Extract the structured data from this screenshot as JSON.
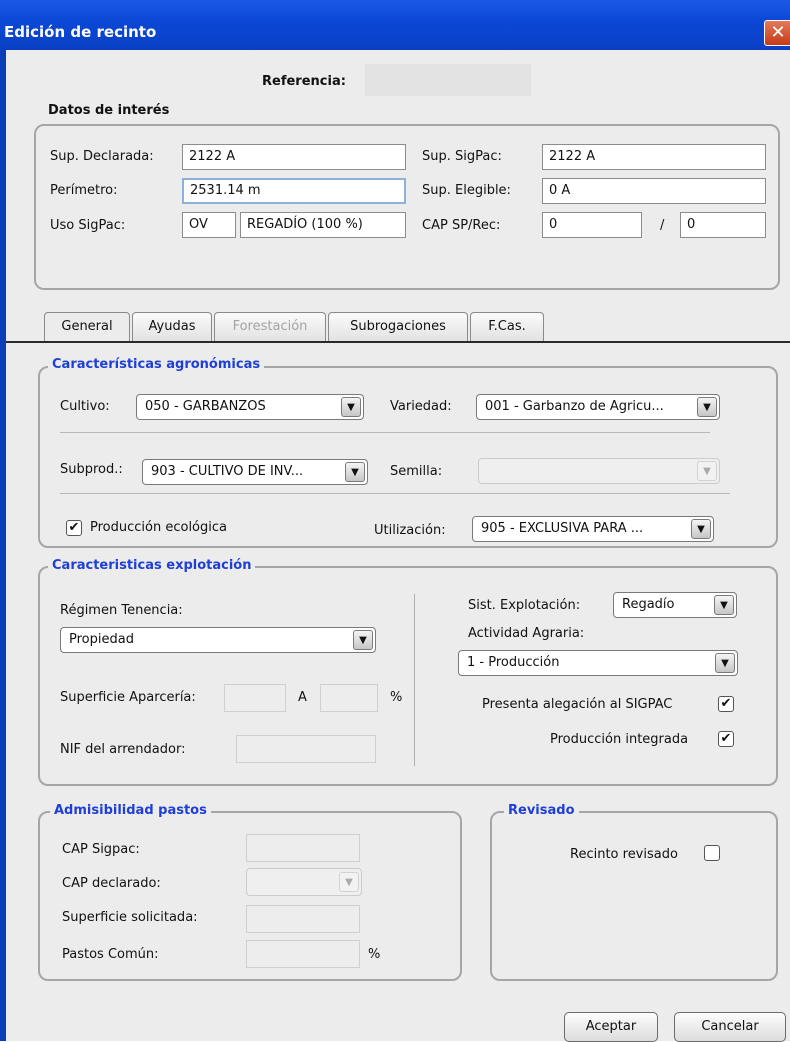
{
  "window": {
    "title": "Edición de recinto",
    "close_glyph": "✕"
  },
  "referencia": {
    "label": "Referencia:",
    "value": ""
  },
  "datos": {
    "title": "Datos de interés",
    "sup_declarada_label": "Sup. Declarada:",
    "sup_declarada_value": "2122 A",
    "perimetro_label": "Perímetro:",
    "perimetro_value": "2531.14 m",
    "uso_sigpac_label": "Uso SigPac:",
    "uso_code": "OV",
    "uso_desc": "REGADÍO (100 %)",
    "sup_sigpac_label": "Sup. SigPac:",
    "sup_sigpac_value": "2122 A",
    "sup_elegible_label": "Sup. Elegible:",
    "sup_elegible_value": "0 A",
    "cap_label": "CAP SP/Rec:",
    "cap_sp_value": "0",
    "cap_sep": "/",
    "cap_rec_value": "0"
  },
  "tabs": [
    {
      "label": "General",
      "selected": true,
      "enabled": true
    },
    {
      "label": "Ayudas",
      "selected": false,
      "enabled": true
    },
    {
      "label": "Forestación",
      "selected": false,
      "enabled": false
    },
    {
      "label": "Subrogaciones",
      "selected": false,
      "enabled": true
    },
    {
      "label": "F.Cas.",
      "selected": false,
      "enabled": true
    }
  ],
  "agro": {
    "title": "Características agronómicas",
    "cultivo_label": "Cultivo:",
    "cultivo_value": "050 - GARBANZOS",
    "variedad_label": "Variedad:",
    "variedad_value": "001 - Garbanzo de Agricu...",
    "subprod_label": "Subprod.:",
    "subprod_value": "903 - CULTIVO DE INV...",
    "semilla_label": "Semilla:",
    "semilla_value": "",
    "prod_eco_label": "Producción ecológica",
    "prod_eco_checked": true,
    "utilizacion_label": "Utilización:",
    "utilizacion_value": "905 - EXCLUSIVA PARA ..."
  },
  "explot": {
    "title": "Caracteristicas explotación",
    "regimen_label": "Régimen Tenencia:",
    "regimen_value": "Propiedad",
    "sup_aparceria_label": "Superficie Aparcería:",
    "unit_a": "A",
    "unit_pct": "%",
    "nif_label": "NIF del arrendador:",
    "sist_label": "Sist. Explotación:",
    "sist_value": "Regadío",
    "actividad_label": "Actividad Agraria:",
    "actividad_value": "1 - Producción",
    "alegacion_label": "Presenta alegación al SIGPAC",
    "alegacion_checked": true,
    "integrada_label": "Producción integrada",
    "integrada_checked": true
  },
  "pastos": {
    "title": "Admisibilidad pastos",
    "cap_sigpac_label": "CAP Sigpac:",
    "cap_declarado_label": "CAP declarado:",
    "sup_solicitada_label": "Superficie solicitada:",
    "pastos_comun_label": "Pastos Común:",
    "unit_pct": "%"
  },
  "revisado": {
    "title": "Revisado",
    "recinto_label": "Recinto revisado",
    "recinto_checked": false
  },
  "buttons": {
    "aceptar": "Aceptar",
    "cancelar": "Cancelar"
  },
  "icons": {
    "dropdown": "▼",
    "check": "✔"
  },
  "colors": {
    "titlebar": "#0b48d6",
    "group_title": "#1f3fd6",
    "window_bg": "#ececec"
  }
}
